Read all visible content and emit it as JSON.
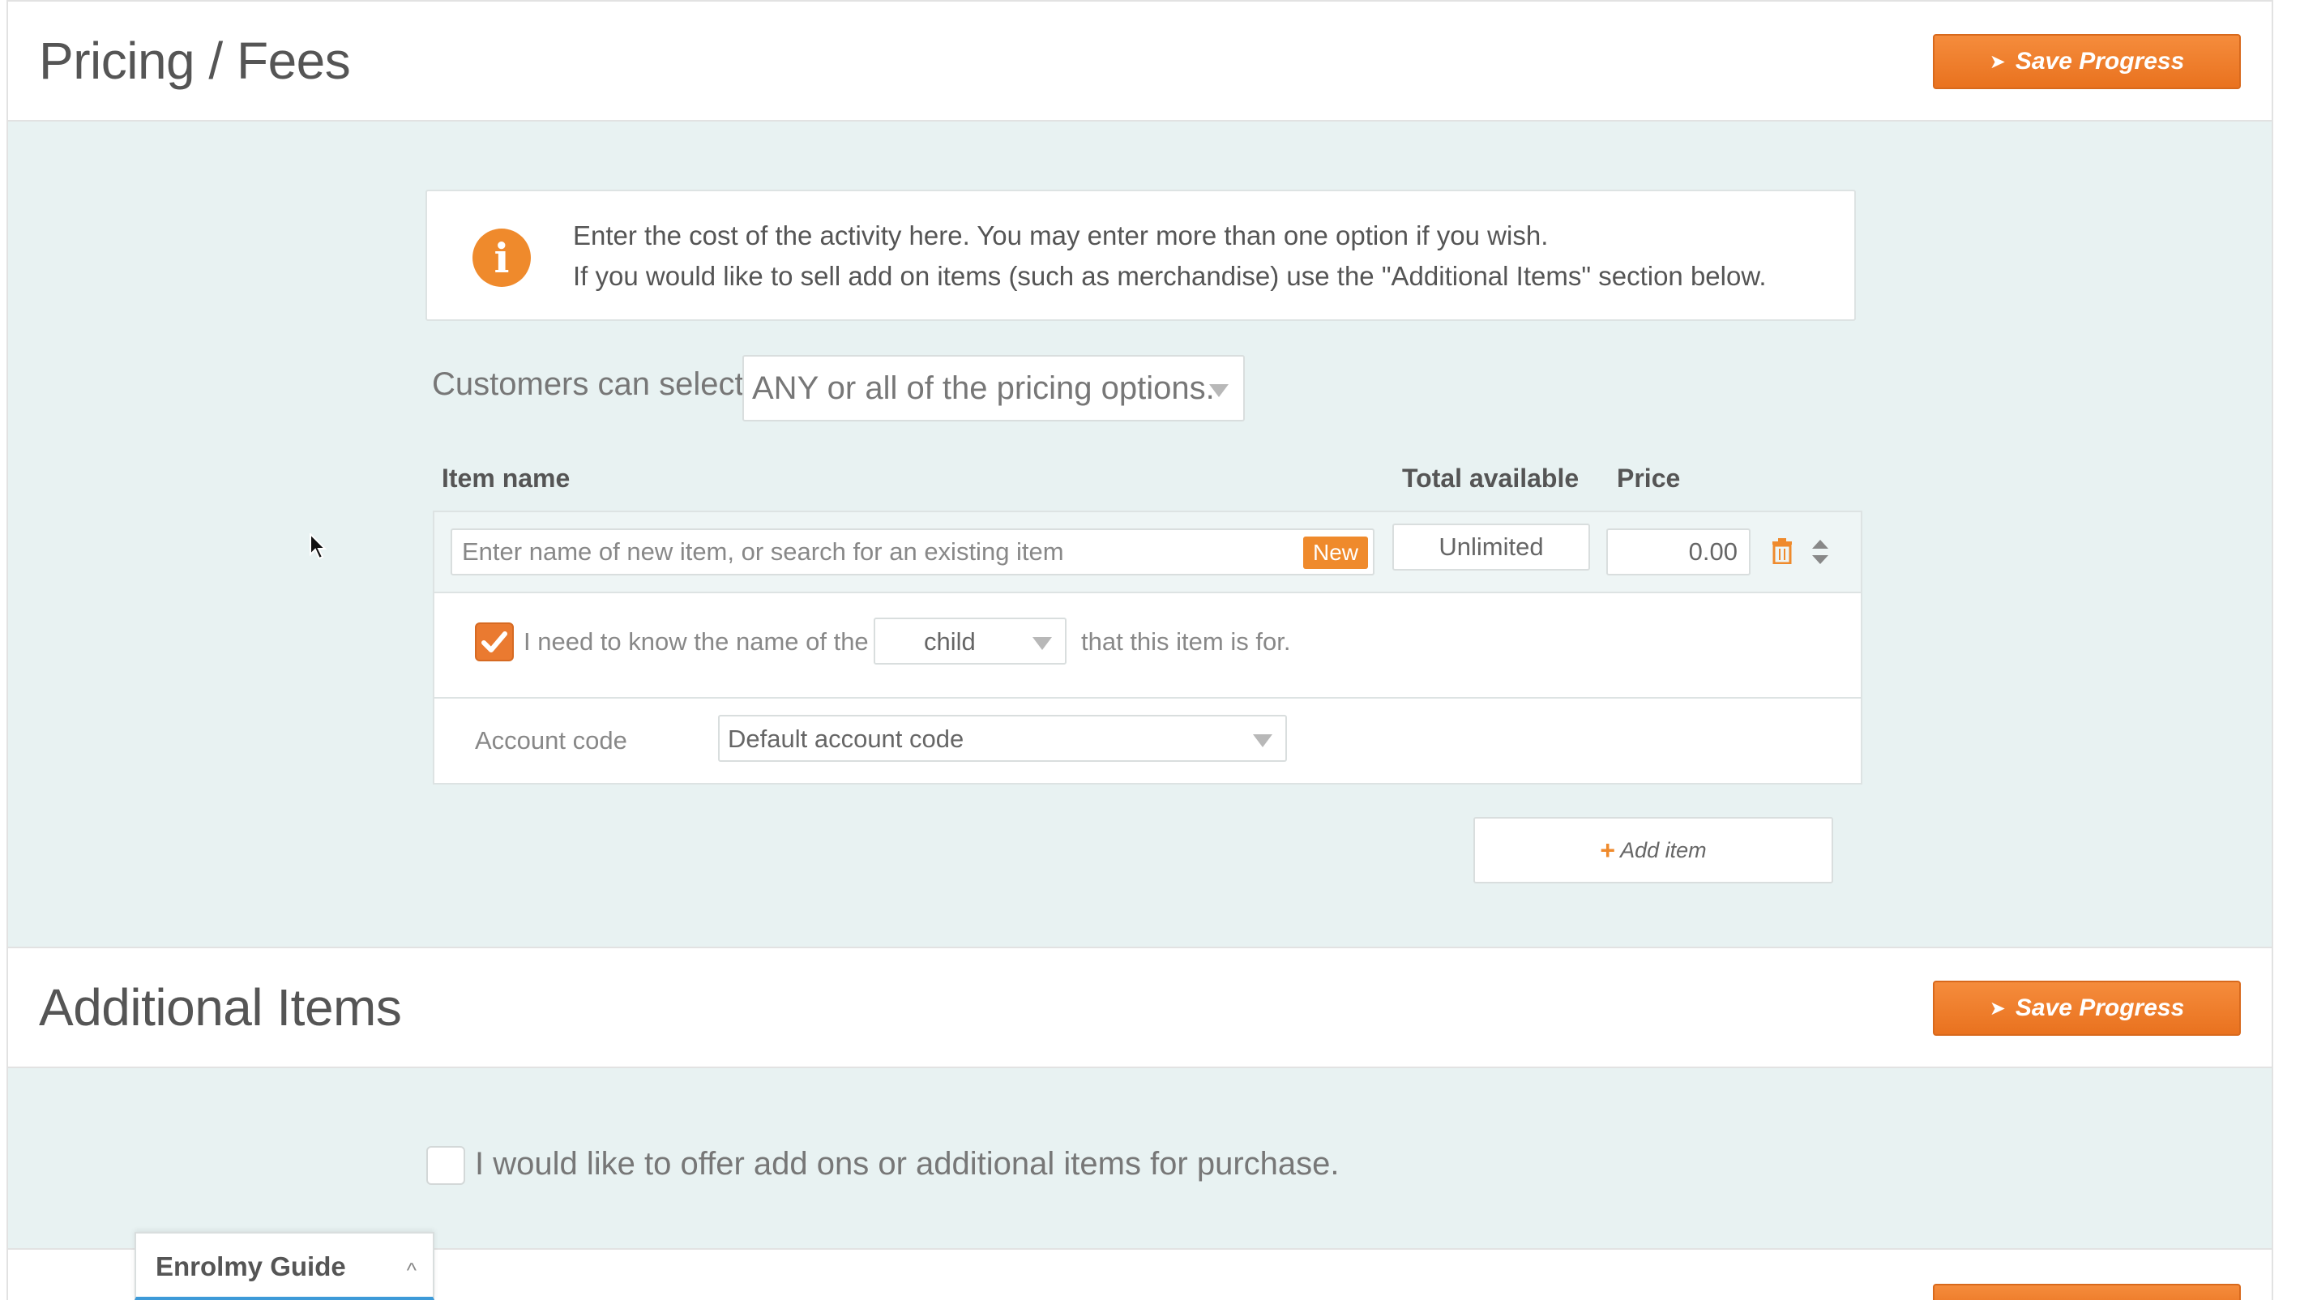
{
  "pricing": {
    "title": "Pricing / Fees",
    "save_label": "Save Progress",
    "info_line1": "Enter the cost of the activity here. You may enter more than one option if you wish.",
    "info_line2": "If you would like to sell add on items (such as merchandise) use the \"Additional Items\" section below.",
    "select_label": "Customers can select",
    "select_value": "ANY or all of the pricing options.",
    "columns": {
      "item_name": "Item name",
      "total_available": "Total available",
      "price": "Price"
    },
    "item": {
      "name_placeholder": "Enter name of new item, or search for an existing item",
      "new_badge": "New",
      "total_available": "Unlimited",
      "price": "0.00",
      "need_name_checked": true,
      "need_name_prefix": "I need to know the name of the",
      "need_name_select": "child",
      "need_name_suffix": "that this item is for.",
      "account_code_label": "Account code",
      "account_code_value": "Default account code"
    },
    "add_item_label": "Add item"
  },
  "additional": {
    "title": "Additional Items",
    "save_label": "Save Progress",
    "offer_label": "I would like to offer add ons or additional items for purchase.",
    "offer_checked": false
  },
  "guide": {
    "title": "Enrolmy Guide"
  },
  "colors": {
    "accent": "#ef8a2c",
    "panel_bg": "#e8f2f2"
  }
}
